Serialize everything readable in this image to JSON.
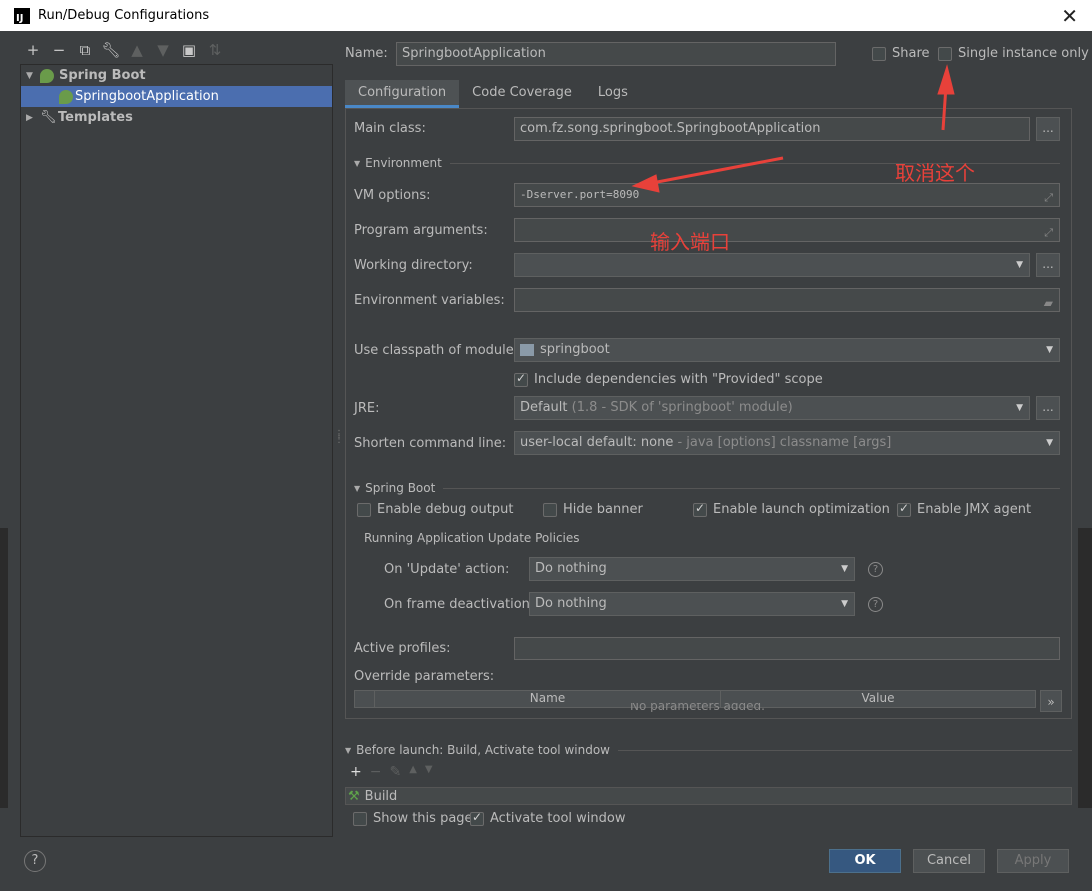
{
  "window": {
    "title": "Run/Debug Configurations",
    "app_icon": "IJ"
  },
  "left_toolbar": {
    "icons": [
      "plus-icon",
      "minus-icon",
      "copy-icon",
      "wrench-icon",
      "arrow-up-icon",
      "arrow-down-icon",
      "folder-plus-icon",
      "sort-icon"
    ]
  },
  "tree": {
    "items": [
      {
        "label": "Spring Boot",
        "expanded": true
      },
      {
        "label": "SpringbootApplication",
        "selected": true
      },
      {
        "label": "Templates",
        "expanded": false
      }
    ]
  },
  "header": {
    "name_label": "Name:",
    "name_value": "SpringbootApplication",
    "share_label": "Share",
    "single_instance_label": "Single instance only"
  },
  "tabs": [
    {
      "label": "Configuration",
      "active": true
    },
    {
      "label": "Code Coverage"
    },
    {
      "label": "Logs"
    }
  ],
  "config": {
    "main_class_label": "Main class:",
    "main_class_value": "com.fz.song.springboot.SpringbootApplication",
    "environment_section": "Environment",
    "vm_options_label": "VM options:",
    "vm_options_value": "-Dserver.port=8090",
    "program_args_label": "Program arguments:",
    "working_dir_label": "Working directory:",
    "env_vars_label": "Environment variables:",
    "classpath_label": "Use classpath of module:",
    "classpath_value": "springboot",
    "include_deps_label": "Include dependencies with \"Provided\" scope",
    "jre_label": "JRE:",
    "jre_value": "Default",
    "jre_hint": "(1.8 - SDK of 'springboot' module)",
    "shorten_label": "Shorten command line:",
    "shorten_value": "user-local default: none",
    "shorten_hint": " - java [options] classname [args]",
    "dots": "..."
  },
  "spring_boot": {
    "section": "Spring Boot",
    "debug_output": "Enable debug output",
    "hide_banner": "Hide banner",
    "launch_opt": "Enable launch optimization",
    "jmx_agent": "Enable JMX agent",
    "update_policies": "Running Application Update Policies",
    "on_update_label": "On 'Update' action:",
    "on_update_value": "Do nothing",
    "on_frame_label": "On frame deactivation:",
    "on_frame_value": "Do nothing",
    "active_profiles_label": "Active profiles:",
    "override_label": "Override parameters:",
    "col_name": "Name",
    "col_value": "Value",
    "empty_text": "No parameters added.",
    "expand": "»"
  },
  "before_launch": {
    "section": "Before launch: Build, Activate tool window",
    "build_item": "Build",
    "show_page": "Show this page",
    "activate_tool": "Activate tool window"
  },
  "buttons": {
    "ok": "OK",
    "cancel": "Cancel",
    "apply": "Apply",
    "help": "?"
  },
  "annotations": {
    "cancel_this": "取消这个",
    "enter_port": "输入端口"
  },
  "colors": {
    "accent": "#4a88c7",
    "selection": "#4b6eaf",
    "annotation": "#e8413a",
    "ok_button": "#365880"
  }
}
